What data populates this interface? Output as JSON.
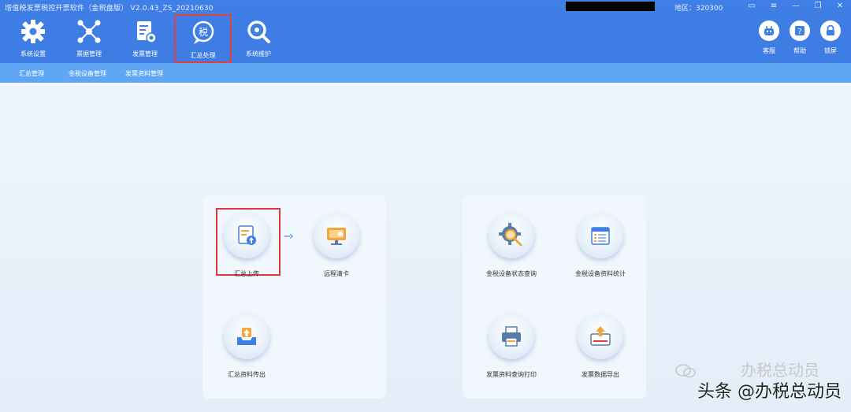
{
  "window": {
    "title": "增值税发票税控开票软件（金税盘版） V2.0.43_ZS_20210630",
    "region": "地区：320300"
  },
  "toolbar": {
    "items": [
      {
        "label": "系统设置",
        "icon": "gear-icon"
      },
      {
        "label": "票据管理",
        "icon": "network-icon"
      },
      {
        "label": "发票管理",
        "icon": "invoice-icon"
      },
      {
        "label": "汇总处理",
        "icon": "tax-summary-icon"
      },
      {
        "label": "系统维护",
        "icon": "wrench-icon"
      }
    ],
    "right": [
      {
        "label": "客服",
        "icon": "robot-icon"
      },
      {
        "label": "帮助",
        "icon": "help-icon"
      },
      {
        "label": "锁屏",
        "icon": "lock-icon"
      }
    ]
  },
  "subnav": [
    "汇总管理",
    "金税设备管理",
    "发票资料管理"
  ],
  "left_panel": {
    "items": [
      {
        "label": "汇总上传",
        "icon": "upload-summary-icon"
      },
      {
        "label": "远程清卡",
        "icon": "monitor-card-icon"
      },
      {
        "label": "汇总资料传出",
        "icon": "tray-export-icon"
      }
    ]
  },
  "right_panel": {
    "items": [
      {
        "label": "金税设备状态查询",
        "icon": "gear-search-icon"
      },
      {
        "label": "金税设备资料统计",
        "icon": "calendar-list-icon"
      },
      {
        "label": "发票资料查询打印",
        "icon": "printer-icon"
      },
      {
        "label": "发票数据导出",
        "icon": "export-data-icon"
      }
    ]
  },
  "watermark": {
    "ghost": "办税总动员",
    "main": "头条 @办税总动员"
  },
  "colors": {
    "toolbar_bg": "#3f7fe6",
    "subnav_bg": "#5fa7f4",
    "highlight": "#d93a3a"
  }
}
